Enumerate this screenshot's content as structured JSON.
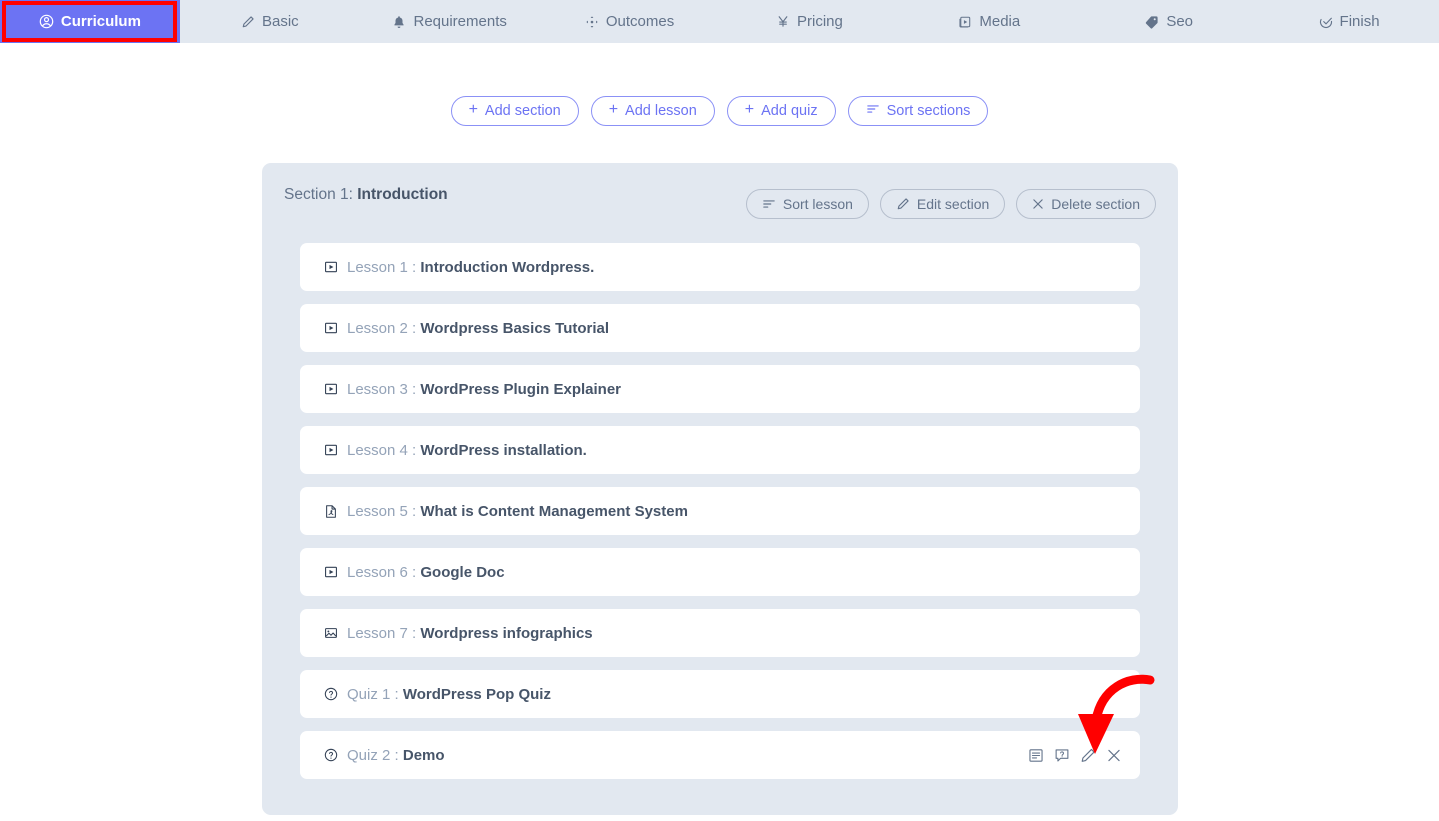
{
  "nav": {
    "tabs": [
      {
        "label": "Curriculum",
        "icon": "user-circle-icon",
        "active": true
      },
      {
        "label": "Basic",
        "icon": "pencil-icon",
        "active": false
      },
      {
        "label": "Requirements",
        "icon": "bell-icon",
        "active": false
      },
      {
        "label": "Outcomes",
        "icon": "move-arrows-icon",
        "active": false
      },
      {
        "label": "Pricing",
        "icon": "yen-icon",
        "active": false
      },
      {
        "label": "Media",
        "icon": "video-box-icon",
        "active": false
      },
      {
        "label": "Seo",
        "icon": "tag-icon",
        "active": false
      },
      {
        "label": "Finish",
        "icon": "check-circle-icon",
        "active": false
      }
    ],
    "active_tab_highlight_color": "#ff0000",
    "active_tab_bg": "#6c73f3"
  },
  "toolbar": {
    "buttons": [
      {
        "label": "Add section",
        "icon": "plus-icon"
      },
      {
        "label": "Add lesson",
        "icon": "plus-icon"
      },
      {
        "label": "Add quiz",
        "icon": "plus-icon"
      },
      {
        "label": "Sort sections",
        "icon": "sort-icon"
      }
    ]
  },
  "section": {
    "prefix": "Section 1: ",
    "name": "Introduction",
    "actions": [
      {
        "label": "Sort lesson",
        "icon": "sort-icon"
      },
      {
        "label": "Edit section",
        "icon": "pencil-icon"
      },
      {
        "label": "Delete section",
        "icon": "close-icon"
      }
    ],
    "items": [
      {
        "prefix": "Lesson 1 : ",
        "title": "Introduction Wordpress.",
        "icon": "video-icon",
        "tools": false
      },
      {
        "prefix": "Lesson 2 : ",
        "title": "Wordpress Basics Tutorial",
        "icon": "video-icon",
        "tools": false
      },
      {
        "prefix": "Lesson 3 : ",
        "title": "WordPress Plugin Explainer",
        "icon": "video-icon",
        "tools": false
      },
      {
        "prefix": "Lesson 4 : ",
        "title": "WordPress installation.",
        "icon": "video-icon",
        "tools": false
      },
      {
        "prefix": "Lesson 5 : ",
        "title": "What is Content Management System",
        "icon": "pdf-icon",
        "tools": false
      },
      {
        "prefix": "Lesson 6 : ",
        "title": "Google Doc",
        "icon": "video-icon",
        "tools": false
      },
      {
        "prefix": "Lesson 7 : ",
        "title": "Wordpress infographics",
        "icon": "image-icon",
        "tools": false
      },
      {
        "prefix": "Quiz 1 : ",
        "title": "WordPress Pop Quiz",
        "icon": "question-circle-icon",
        "tools": false
      },
      {
        "prefix": "Quiz 2 : ",
        "title": "Demo",
        "icon": "question-circle-icon",
        "tools": true
      }
    ]
  },
  "row_tools": [
    {
      "name": "quiz-details-icon"
    },
    {
      "name": "quiz-question-icon"
    },
    {
      "name": "edit-icon"
    },
    {
      "name": "delete-icon"
    }
  ],
  "annotation": {
    "arrow_color": "#ff0000",
    "points_to": "edit-icon"
  }
}
